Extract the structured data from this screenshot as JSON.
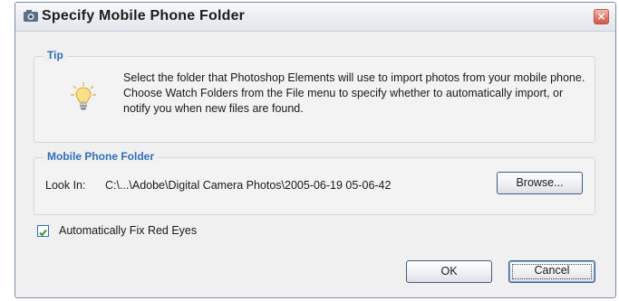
{
  "window": {
    "title": "Specify Mobile Phone Folder",
    "close_glyph": "×"
  },
  "tip": {
    "legend": "Tip",
    "icon": "lightbulb-icon",
    "text": "Select the folder that Photoshop Elements will use to import photos from your mobile phone. Choose Watch Folders from the File menu to specify whether to automatically import, or notify you when new files are found."
  },
  "folder": {
    "legend": "Mobile Phone Folder",
    "look_in_label": "Look In:",
    "path": "C:\\...\\Adobe\\Digital Camera Photos\\2005-06-19 05-06-42",
    "browse_label": "Browse..."
  },
  "options": {
    "auto_fix_red_eyes_label": "Automatically Fix Red Eyes",
    "auto_fix_red_eyes_checked": true
  },
  "buttons": {
    "ok_label": "OK",
    "cancel_label": "Cancel"
  },
  "colors": {
    "legend_blue": "#2f6fba",
    "close_red": "#d35a4c",
    "dialog_bg": "#f0f0f0"
  }
}
